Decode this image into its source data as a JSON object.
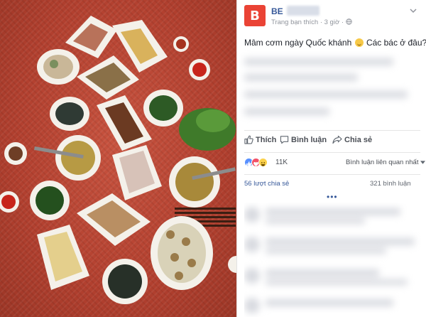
{
  "post": {
    "page_name": "BE",
    "meta_text": "Trang bạn thích · 3 giờ ·",
    "menu_icon": "chevron-down-icon",
    "text": "Mâm cơm ngày Quốc khánh",
    "text_after_emoji": "Các bác ở đâu??",
    "avatar_letter": "B",
    "avatar_color": "#ea4335"
  },
  "actions": {
    "like": "Thích",
    "comment": "Bình luận",
    "share": "Chia sẻ"
  },
  "reactions": {
    "count": "11K",
    "sort_label": "Bình luận liên quan nhất",
    "icons": [
      "like-icon",
      "love-icon",
      "haha-icon"
    ]
  },
  "stats": {
    "shares": "56 lượt chia sẻ",
    "comments": "321 bình luận",
    "more": "•••"
  },
  "colors": {
    "link_blue": "#365899",
    "tablecloth_red": "#b2402f",
    "text_gray": "#90949c"
  }
}
